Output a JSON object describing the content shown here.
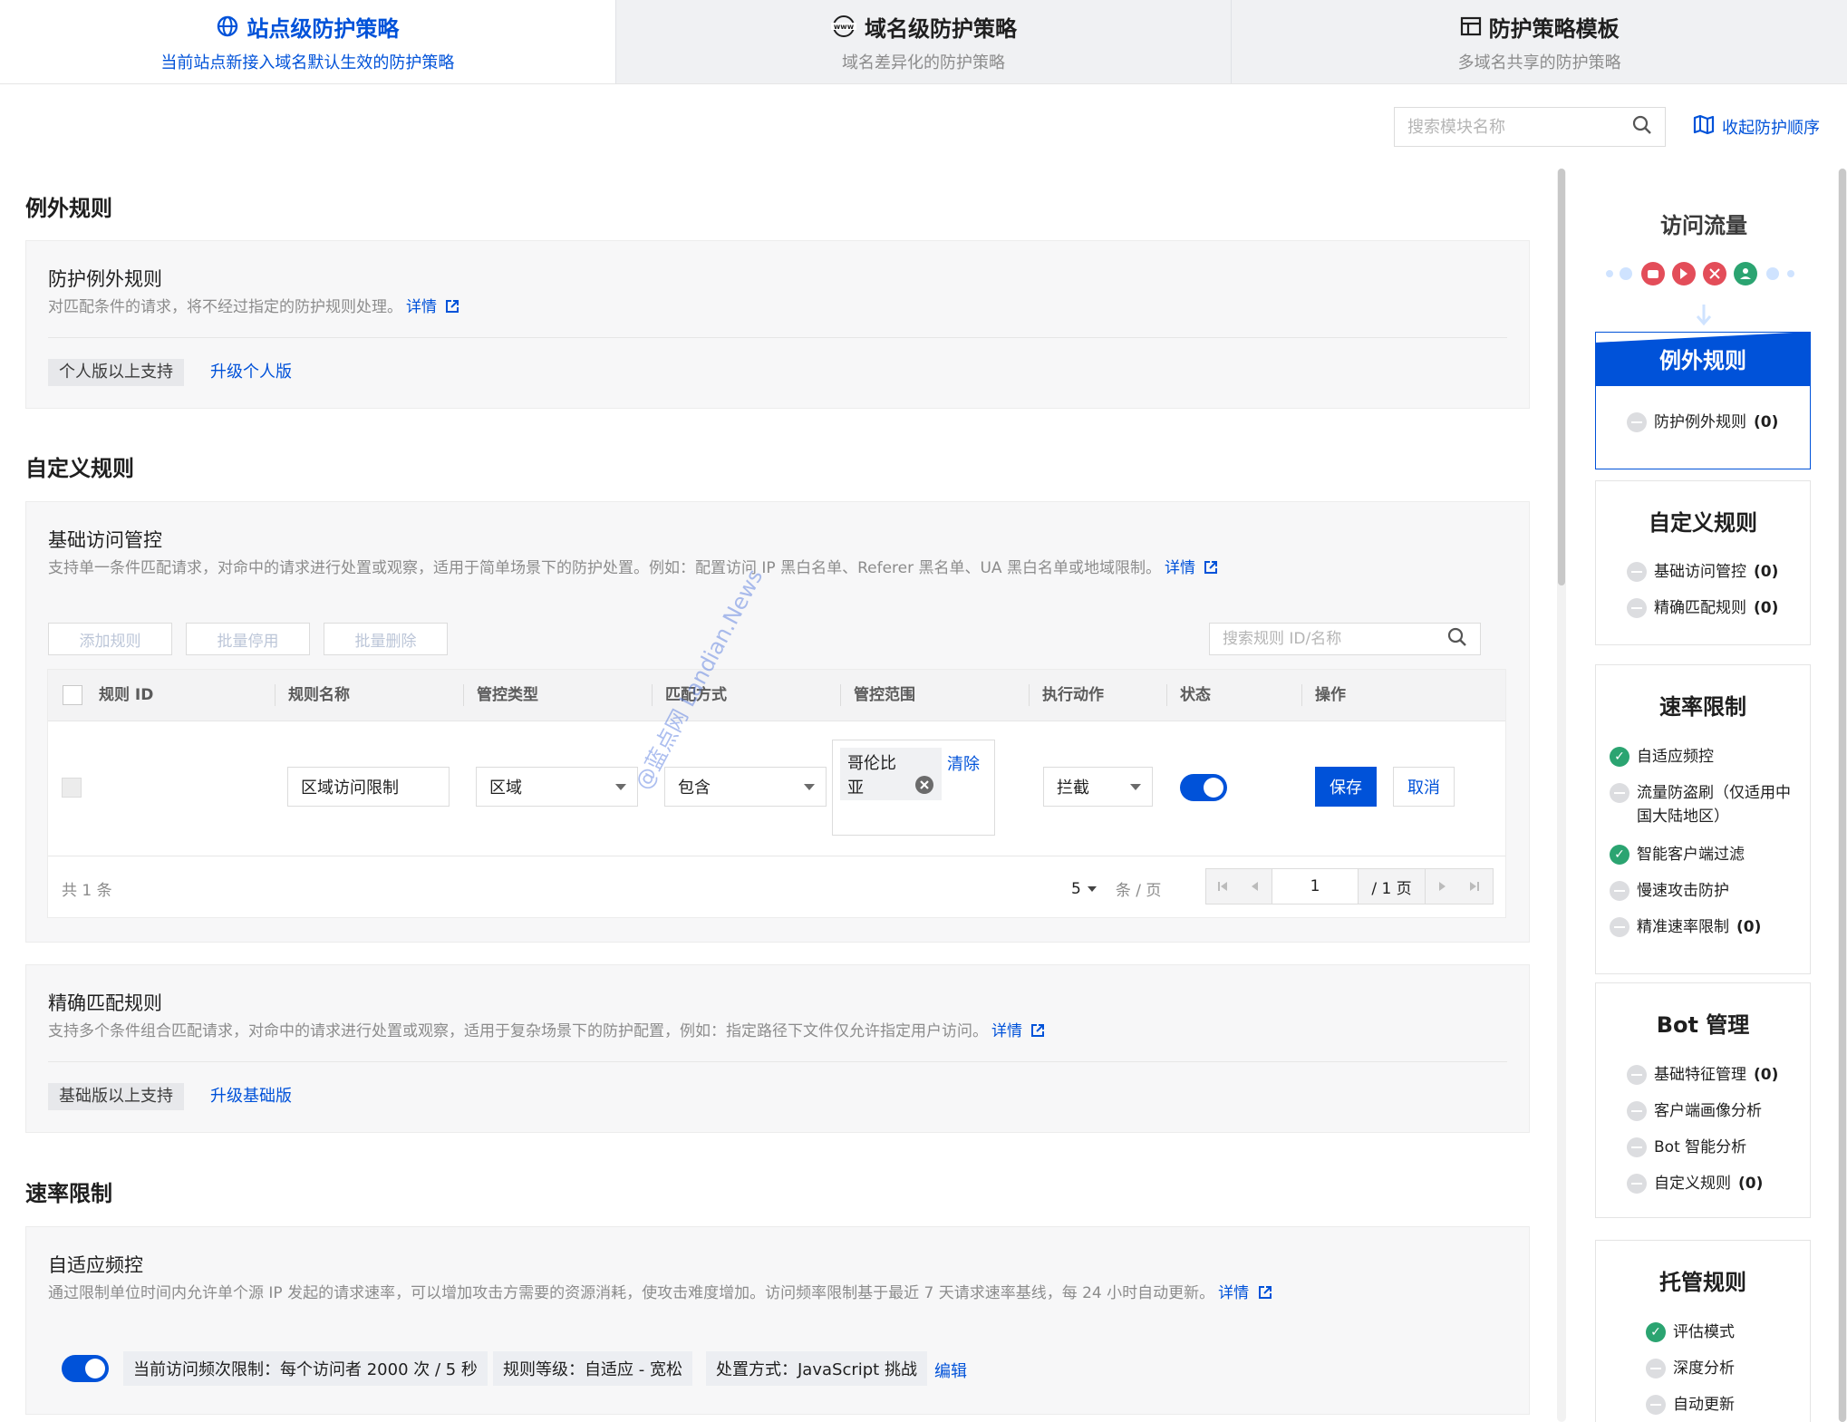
{
  "tabs": [
    {
      "title": "站点级防护策略",
      "subtitle": "当前站点新接入域名默认生效的防护策略",
      "icon": "globe-icon",
      "active": true
    },
    {
      "title": "域名级防护策略",
      "subtitle": "域名差异化的防护策略",
      "icon": "www-icon",
      "active": false
    },
    {
      "title": "防护策略模板",
      "subtitle": "多域名共享的防护策略",
      "icon": "template-icon",
      "active": false
    }
  ],
  "toolbar": {
    "search_placeholder": "搜索模块名称",
    "collapse_label": "收起防护顺序"
  },
  "exception": {
    "section_title": "例外规则",
    "card_title": "防护例外规则",
    "desc": "对匹配条件的请求，将不经过指定的防护规则处理。",
    "detail": "详情",
    "tag": "个人版以上支持",
    "upgrade": "升级个人版"
  },
  "custom": {
    "section_title": "自定义规则",
    "card_title": "基础访问管控",
    "desc": "支持单一条件匹配请求，对命中的请求进行处置或观察，适用于简单场景下的防护处置。例如：配置访问 IP 黑白名单、Referer 黑名单、UA 黑白名单或地域限制。",
    "detail": "详情",
    "btn_add": "添加规则",
    "btn_disable": "批量停用",
    "btn_delete": "批量删除",
    "rule_search_placeholder": "搜索规则 ID/名称",
    "columns": [
      "规则 ID",
      "规则名称",
      "管控类型",
      "匹配方式",
      "管控范围",
      "执行动作",
      "状态",
      "操作"
    ],
    "row": {
      "name": "区域访问限制",
      "type": "区域",
      "match": "包含",
      "scope_value": "哥伦比亚",
      "scope_clear": "清除",
      "action": "拦截",
      "enabled": true,
      "save": "保存",
      "cancel": "取消"
    },
    "total": "共  1  条",
    "page_size": "5",
    "page_size_unit": "条 / 页",
    "page_input": "1",
    "page_total": "/ 1 页"
  },
  "precise": {
    "card_title": "精确匹配规则",
    "desc": "支持多个条件组合匹配请求，对命中的请求进行处置或观察，适用于复杂场景下的防护配置，例如：指定路径下文件仅允许指定用户访问。",
    "detail": "详情",
    "tag": "基础版以上支持",
    "upgrade": "升级基础版"
  },
  "rate": {
    "section_title": "速率限制",
    "card_title": "自适应频控",
    "desc": "通过限制单位时间内允许单个源 IP 发起的请求速率，可以增加攻击方需要的资源消耗，使攻击难度增加。访问频率限制基于最近 7 天请求速率基线，每 24 小时自动更新。",
    "detail": "详情",
    "enabled": true,
    "limit": "当前访问频次限制：每个访问者 2000 次 / 5 秒",
    "level": "规则等级：自适应 - 宽松",
    "method": "处置方式：JavaScript 挑战",
    "edit": "编辑"
  },
  "watermark": "@蓝点网 Landian.News",
  "panel": {
    "flow_title": "访问流量",
    "groups": [
      {
        "title": "例外规则",
        "active": true,
        "items": [
          {
            "label": "防护例外规则",
            "count": "(0)",
            "status": "none"
          }
        ]
      },
      {
        "title": "自定义规则",
        "items": [
          {
            "label": "基础访问管控",
            "count": "(0)",
            "status": "none"
          },
          {
            "label": "精确匹配规则",
            "count": "(0)",
            "status": "none"
          }
        ]
      },
      {
        "title": "速率限制",
        "items": [
          {
            "label": "自适应频控",
            "count": "",
            "status": "ok"
          },
          {
            "label": "流量防盗刷（仅适用中国大陆地区）",
            "count": "",
            "status": "none"
          },
          {
            "label": "智能客户端过滤",
            "count": "",
            "status": "ok"
          },
          {
            "label": "慢速攻击防护",
            "count": "",
            "status": "none"
          },
          {
            "label": "精准速率限制",
            "count": "(0)",
            "status": "none"
          }
        ]
      },
      {
        "title": "Bot 管理",
        "items": [
          {
            "label": "基础特征管理",
            "count": "(0)",
            "status": "none"
          },
          {
            "label": "客户端画像分析",
            "count": "",
            "status": "none"
          },
          {
            "label": "Bot 智能分析",
            "count": "",
            "status": "none"
          },
          {
            "label": "自定义规则",
            "count": "(0)",
            "status": "none"
          }
        ]
      },
      {
        "title": "托管规则",
        "items": [
          {
            "label": "评估模式",
            "count": "",
            "status": "ok"
          },
          {
            "label": "深度分析",
            "count": "",
            "status": "none"
          },
          {
            "label": "自动更新",
            "count": "",
            "status": "none"
          }
        ]
      }
    ]
  },
  "colors": {
    "primary": "#0052d9",
    "success": "#2ba471",
    "flow_red": "#e34d59"
  }
}
